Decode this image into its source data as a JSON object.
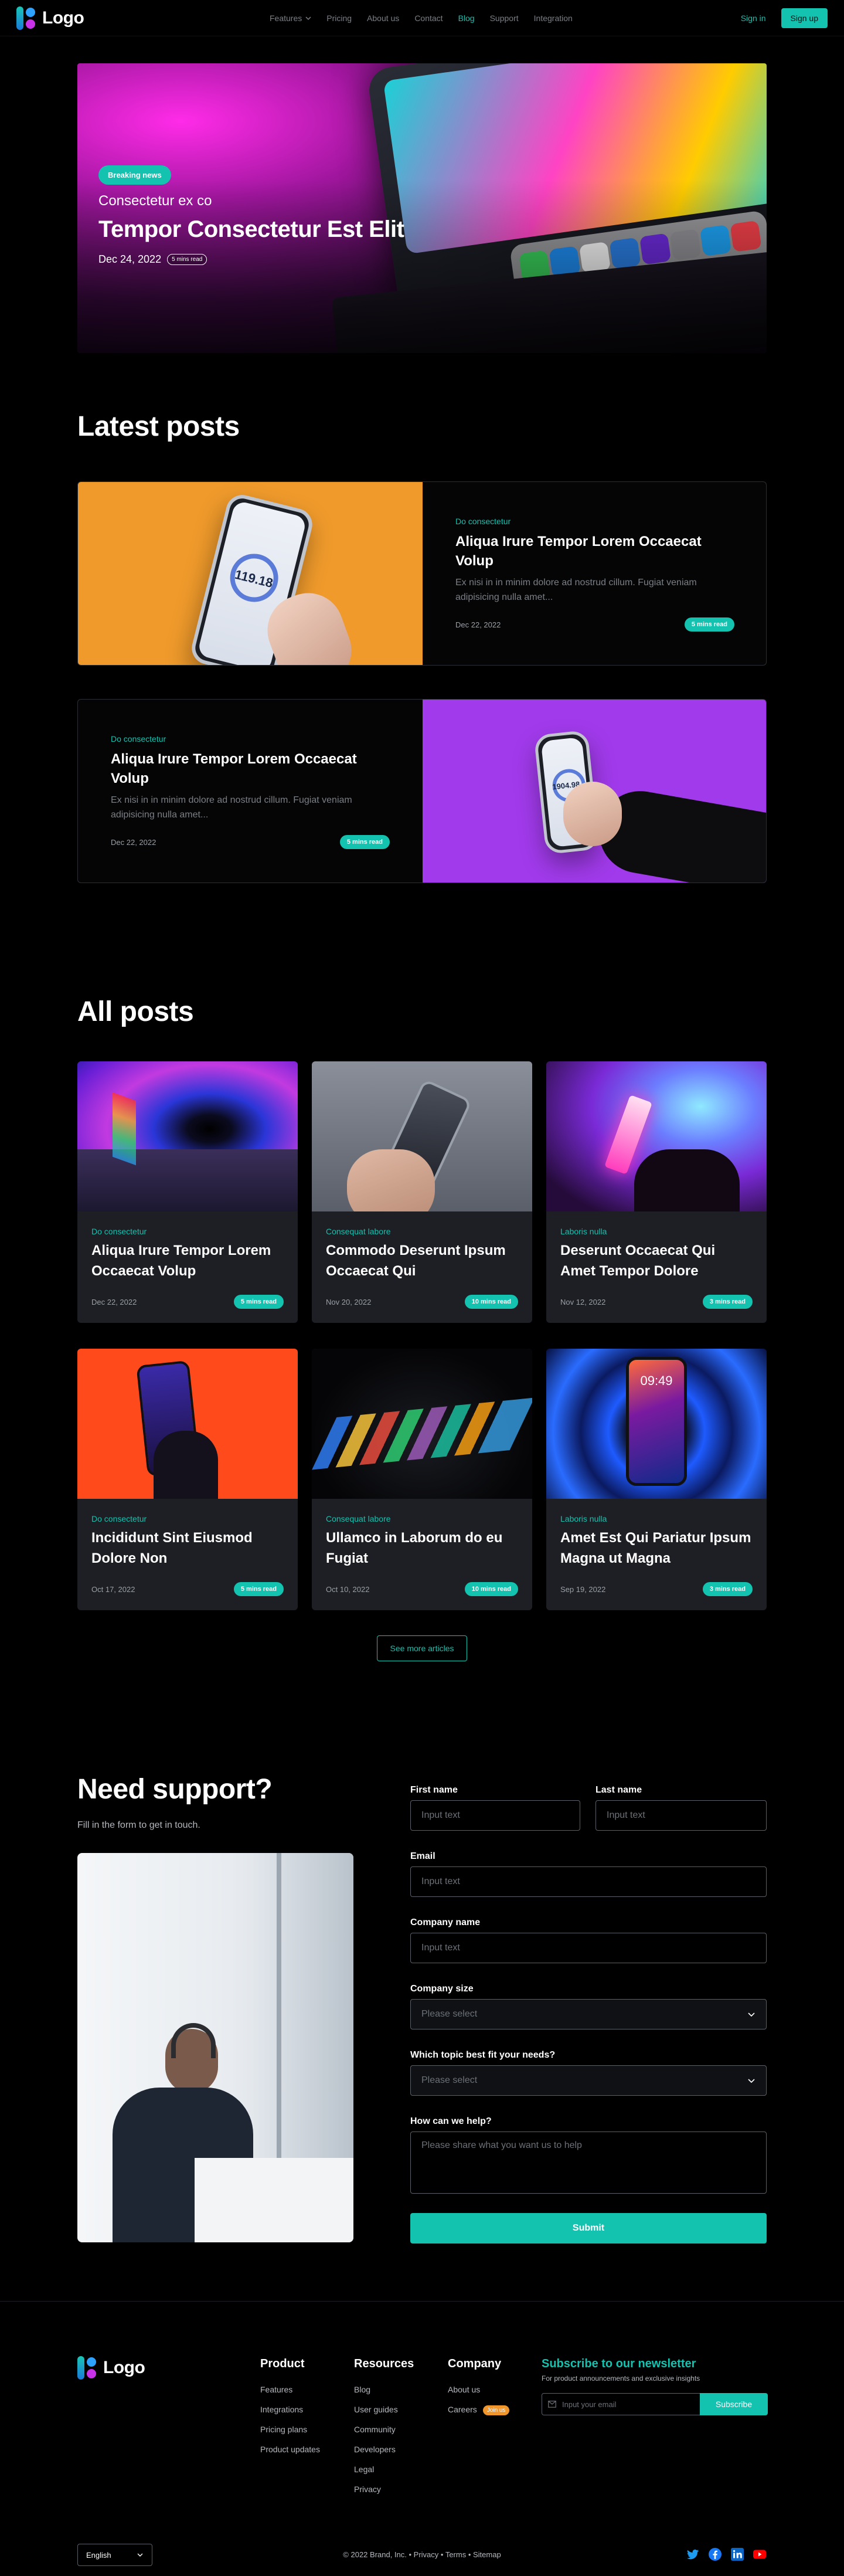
{
  "colors": {
    "accent": "#14C2B0",
    "background": "#000000",
    "card": "#1D1F24",
    "hiring": "#F0962C"
  },
  "nav": {
    "logo": "Logo",
    "links": [
      "Features",
      "Pricing",
      "About us",
      "Contact",
      "Blog",
      "Support",
      "Integration"
    ],
    "active_link": "Blog",
    "signin": "Sign in",
    "signup": "Sign up"
  },
  "hero": {
    "badge": "Breaking news",
    "subtitle": "Consectetur ex co",
    "title": "Tempor Consectetur Est Elit",
    "date": "Dec 24, 2022",
    "read_time": "5 mins read"
  },
  "latest": {
    "title": "Latest posts",
    "posts": [
      {
        "category": "Do consectetur",
        "title": "Aliqua Irure Tempor Lorem Occaecat Volup",
        "excerpt": "Ex nisi in in minim dolore ad nostrud cillum. Fugiat veniam adipisicing nulla amet...",
        "date": "Dec 22, 2022",
        "read_time": "5 mins read",
        "phone_reading": "119.18"
      },
      {
        "category": "Do consectetur",
        "title": "Aliqua Irure Tempor Lorem Occaecat Volup",
        "excerpt": "Ex nisi in in minim dolore ad nostrud cillum. Fugiat veniam adipisicing nulla amet...",
        "date": "Dec 22, 2022",
        "read_time": "5 mins read",
        "phone_reading": "1904.98"
      }
    ]
  },
  "all_posts": {
    "title": "All posts",
    "posts": [
      {
        "category": "Do consectetur",
        "title": "Aliqua Irure Tempor Lorem Occaecat Volup",
        "date": "Dec 22, 2022",
        "read_time": "5 mins read"
      },
      {
        "category": "Consequat labore",
        "title": "Commodo Deserunt Ipsum Occaecat Qui",
        "date": "Nov 20, 2022",
        "read_time": "10 mins read"
      },
      {
        "category": "Laboris nulla",
        "title": "Deserunt Occaecat Qui Amet Tempor Dolore",
        "date": "Nov 12, 2022",
        "read_time": "3 mins read"
      },
      {
        "category": "Do consectetur",
        "title": "Incididunt Sint Eiusmod Dolore Non",
        "date": "Oct 17, 2022",
        "read_time": "5 mins read"
      },
      {
        "category": "Consequat labore",
        "title": "Ullamco in Laborum do eu Fugiat",
        "date": "Oct 10, 2022",
        "read_time": "10 mins read"
      },
      {
        "category": "Laboris nulla",
        "title": "Amet Est Qui Pariatur Ipsum Magna ut Magna",
        "date": "Sep 19, 2022",
        "read_time": "3 mins read",
        "phone_time": "09:49"
      }
    ],
    "see_more": "See more articles"
  },
  "support": {
    "title": "Need support?",
    "subtitle": "Fill in the form to get in touch.",
    "first_name_label": "First name",
    "first_name_placeholder": "Input text",
    "last_name_label": "Last name",
    "last_name_placeholder": "Input text",
    "email_label": "Email",
    "email_placeholder": "Input text",
    "company_label": "Company name",
    "company_placeholder": "Input text",
    "size_label": "Company size",
    "size_value": "Please select",
    "topic_label": "Which topic best fit your needs?",
    "topic_value": "Please select",
    "help_label": "How can we help?",
    "help_placeholder": "Please share what you want us to help",
    "submit": "Submit"
  },
  "footer": {
    "logo": "Logo",
    "product_title": "Product",
    "product_links": [
      "Features",
      "Integrations",
      "Pricing plans",
      "Product updates"
    ],
    "resources_title": "Resources",
    "resources_links": [
      "Blog",
      "User guides",
      "Community",
      "Developers",
      "Legal",
      "Privacy"
    ],
    "company_title": "Company",
    "company_links": [
      "About us",
      "Careers"
    ],
    "hiring_badge": "Join us",
    "newsletter_title": "Subscribe to our newsletter",
    "newsletter_sub": "For product announcements and exclusive insights",
    "newsletter_placeholder": "Input your email",
    "subscribe": "Subscribe",
    "language": "English",
    "copyright": "© 2022 Brand, Inc. • Privacy • Terms • Sitemap",
    "socials": [
      "twitter-icon",
      "facebook-icon",
      "linkedin-icon",
      "youtube-icon"
    ]
  }
}
